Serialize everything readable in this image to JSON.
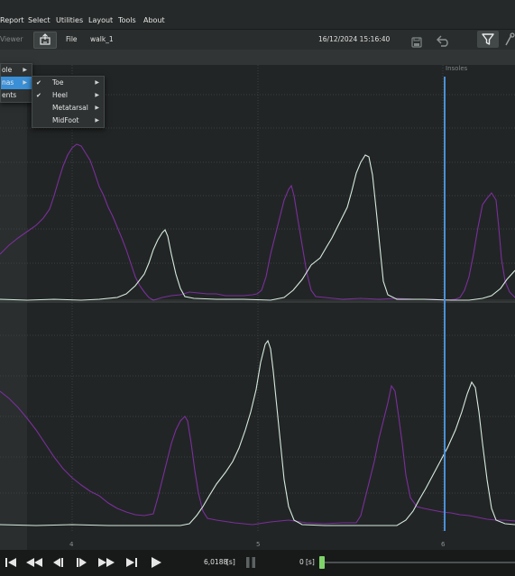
{
  "menubar": {
    "items": [
      "Report",
      "Select",
      "Utilities",
      "Layout",
      "Tools",
      "About"
    ]
  },
  "toolbar": {
    "viewer_label": "Viewer",
    "file_label": "File",
    "file_name": "walk_1",
    "datetime": "16/12/2024 15:16:40"
  },
  "plot": {
    "track_label": "Insoles",
    "x_ticks": [
      "4",
      "5",
      "6"
    ],
    "colors": {
      "purple": "#7a2f9e",
      "white": "#d6eadf",
      "cursor": "#4a90d9",
      "grid": "#3a4040"
    }
  },
  "context_menu": {
    "level1": [
      {
        "label": "ole",
        "has_submenu": true
      },
      {
        "label": "nas",
        "has_submenu": true,
        "highlighted": true
      },
      {
        "label": "ents",
        "has_submenu": false
      }
    ],
    "level2": [
      {
        "label": "Toe",
        "checked": true,
        "has_submenu": true
      },
      {
        "label": "Heel",
        "checked": true,
        "has_submenu": true
      },
      {
        "label": "Metatarsal",
        "checked": false,
        "has_submenu": true
      },
      {
        "label": "MidFoot",
        "checked": false,
        "has_submenu": true
      }
    ]
  },
  "playback": {
    "time_value": "6,0188",
    "time_unit": "[s]",
    "offset_value": "0",
    "offset_unit": "[s]"
  }
}
